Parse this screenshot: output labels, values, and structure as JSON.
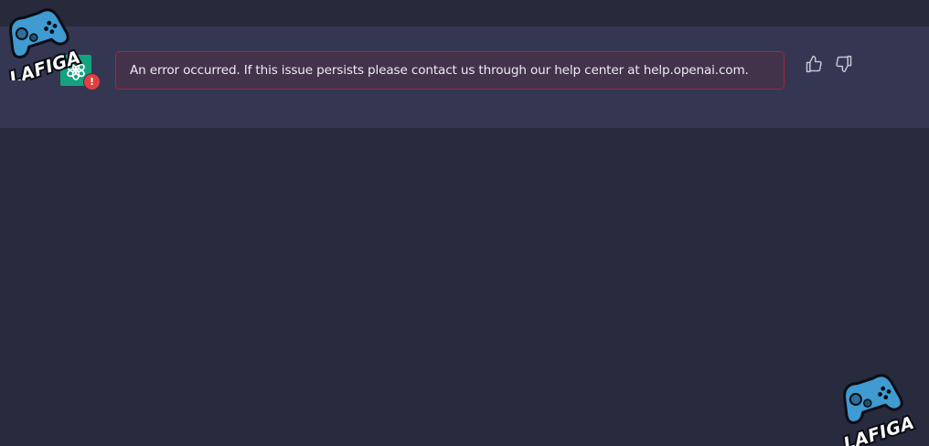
{
  "conversation": {
    "message": {
      "error_text": "An error occurred. If this issue persists please contact us through our help center at help.openai.com.",
      "avatar_icon": "openai-logo-icon",
      "badge_icon": "exclamation-icon",
      "badge_glyph": "!"
    },
    "feedback": {
      "thumbs_up_icon": "thumbs-up-icon",
      "thumbs_down_icon": "thumbs-down-icon"
    }
  },
  "watermark": {
    "text": "LAFIGA",
    "icon": "gamepad-icon"
  },
  "colors": {
    "page_background": "#282a3d",
    "message_background": "#353752",
    "avatar_background": "#14a37f",
    "error_border": "#a5243a",
    "error_background": "#42324a",
    "error_text": "#ececf1",
    "badge_background": "#e23f3f"
  }
}
